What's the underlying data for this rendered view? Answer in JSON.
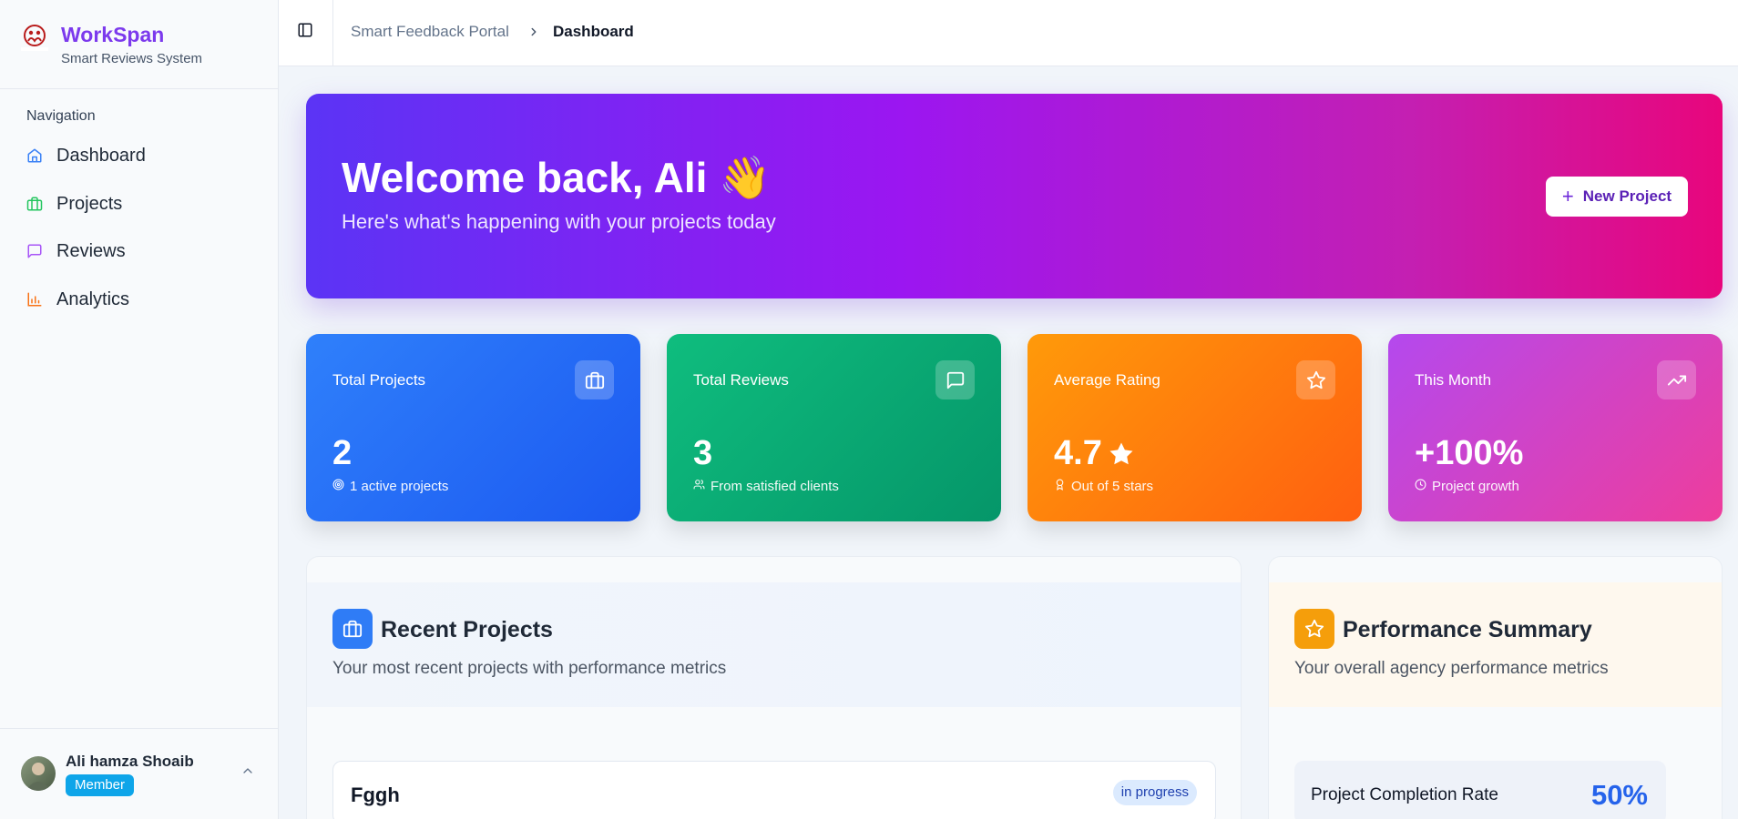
{
  "brand": {
    "name": "WorkSpan",
    "subtitle": "Smart Reviews System",
    "logo_text": "WORKSPAN"
  },
  "sidebar": {
    "nav_title": "Navigation",
    "items": [
      {
        "label": "Dashboard",
        "icon": "home-icon",
        "color": "#3b82f6"
      },
      {
        "label": "Projects",
        "icon": "briefcase-icon",
        "color": "#22c55e"
      },
      {
        "label": "Reviews",
        "icon": "message-icon",
        "color": "#a855f7"
      },
      {
        "label": "Analytics",
        "icon": "bar-chart-icon",
        "color": "#f97316"
      }
    ],
    "user": {
      "name": "Ali hamza Shoaib",
      "role": "Member"
    }
  },
  "topbar": {
    "breadcrumb": [
      "Smart Feedback Portal",
      "Dashboard"
    ]
  },
  "hero": {
    "title": "Welcome back, Ali 👋",
    "subtitle": "Here's what's happening with your projects today",
    "button_label": "New Project"
  },
  "stats": [
    {
      "title": "Total Projects",
      "value": "2",
      "footer": "1 active projects",
      "icon": "briefcase-icon",
      "footer_icon": "target-icon",
      "colors": [
        "#2f80fb",
        "#1c59f0"
      ]
    },
    {
      "title": "Total Reviews",
      "value": "3",
      "footer": "From satisfied clients",
      "icon": "message-icon",
      "footer_icon": "users-icon",
      "colors": [
        "#0fbd7e",
        "#059669"
      ]
    },
    {
      "title": "Average Rating",
      "value": "4.7",
      "footer": "Out of 5 stars",
      "icon": "star-icon",
      "footer_icon": "award-icon",
      "colors": [
        "#ff9a0a",
        "#ff5f10"
      ]
    },
    {
      "title": "This Month",
      "value": "+100%",
      "footer": "Project growth",
      "icon": "trending-up-icon",
      "footer_icon": "clock-icon",
      "colors": [
        "#b449ee",
        "#ee3d9c"
      ]
    }
  ],
  "recent_projects": {
    "title": "Recent Projects",
    "subtitle": "Your most recent projects with performance metrics",
    "items": [
      {
        "name": "Fggh",
        "status": "in progress"
      }
    ]
  },
  "performance": {
    "title": "Performance Summary",
    "subtitle": "Your overall agency performance metrics",
    "metrics": [
      {
        "label": "Project Completion Rate",
        "value": "50%"
      }
    ]
  }
}
